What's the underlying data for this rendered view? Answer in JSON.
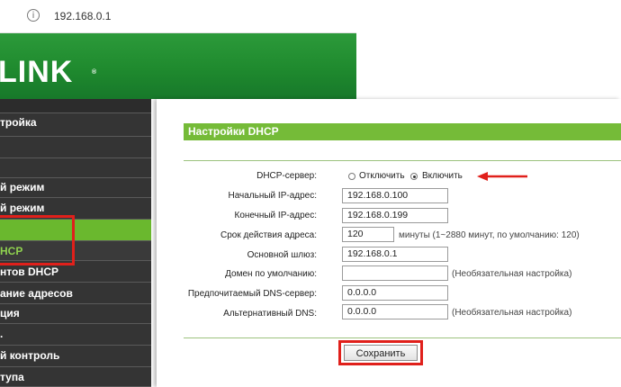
{
  "browser": {
    "url": "192.168.0.1"
  },
  "brand": {
    "logo_text": "LINK",
    "registered_mark": "®"
  },
  "sidebar": {
    "items": [
      {
        "label": ""
      },
      {
        "label": "тройка"
      },
      {
        "label": ""
      },
      {
        "label": ""
      },
      {
        "label": "й режим"
      },
      {
        "label": ""
      },
      {
        "label": "HCP"
      },
      {
        "label": "нтов DHCP"
      },
      {
        "label": "ание адресов"
      },
      {
        "label": "ция"
      },
      {
        "label": "."
      },
      {
        "label": "й контроль"
      },
      {
        "label": "тупа"
      }
    ]
  },
  "form": {
    "title": "Настройки DHCP",
    "dhcp_server": {
      "label": "DHCP-сервер:",
      "options": [
        "Отключить",
        "Включить"
      ],
      "selected": "Включить"
    },
    "start_ip": {
      "label": "Начальный IP-адрес:",
      "value": "192.168.0.100"
    },
    "end_ip": {
      "label": "Конечный IP-адрес:",
      "value": "192.168.0.199"
    },
    "lease_time": {
      "label": "Срок действия адреса:",
      "value": "120",
      "note": "минуты (1~2880 минут, по умолчанию: 120)"
    },
    "gateway": {
      "label": "Основной шлюз:",
      "value": "192.168.0.1"
    },
    "domain": {
      "label": "Домен по умолчанию:",
      "value": "",
      "note": "(Необязательная настройка)"
    },
    "dns_primary": {
      "label": "Предпочитаемый DNS-сервер:",
      "value": "0.0.0.0"
    },
    "dns_alt": {
      "label": "Альтернативный DNS:",
      "value": "0.0.0.0",
      "note": "(Необязательная настройка)"
    },
    "save_label": "Сохранить"
  },
  "colors": {
    "brand_green": "#1f8a2e",
    "active_menu": "#6ab82e",
    "title_bar": "#75bb38",
    "annotation_red": "#e0201b"
  }
}
